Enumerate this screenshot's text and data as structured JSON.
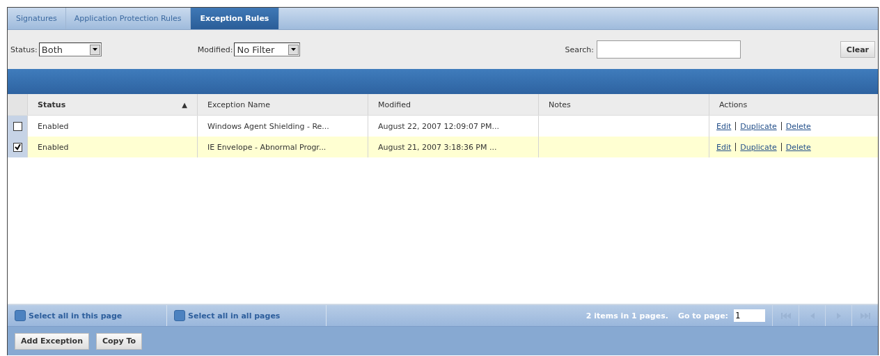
{
  "tabs": [
    {
      "label": "Signatures",
      "selected": false
    },
    {
      "label": "Application Protection Rules",
      "selected": false
    },
    {
      "label": "Exception Rules",
      "selected": true
    }
  ],
  "filters": {
    "status_label": "Status:",
    "status_value": "Both",
    "modified_label": "Modified:",
    "modified_value": "No Filter",
    "search_label": "Search:",
    "clear_button": "Clear"
  },
  "table": {
    "columns": [
      {
        "label": "Status",
        "sorted": true
      },
      {
        "label": "Exception Name",
        "sorted": false
      },
      {
        "label": "Modified",
        "sorted": false
      },
      {
        "label": "Notes",
        "sorted": false
      },
      {
        "label": "Actions",
        "sorted": false
      }
    ],
    "sort_arrow": "▲",
    "rows": [
      {
        "checked": false,
        "selected": false,
        "status": "Enabled",
        "name": "Windows Agent Shielding - Re...",
        "modified": "August 22, 2007 12:09:07 PM...",
        "actions": [
          "Edit",
          "Duplicate",
          "Delete"
        ]
      },
      {
        "checked": true,
        "selected": true,
        "status": "Enabled",
        "name": "IE Envelope - Abnormal Progr...",
        "modified": "August 21, 2007 3:18:36 PM ...",
        "actions": [
          "Edit",
          "Duplicate",
          "Delete"
        ]
      }
    ]
  },
  "footer": {
    "select_page": "Select all in this page",
    "select_page_checked": false,
    "select_all": "Select all in all pages",
    "select_all_checked": false,
    "summary": "2 items in 1 pages.",
    "goto_label": "Go to page:",
    "goto_value": "1"
  },
  "buttons": [
    "Add Exception",
    "Copy To"
  ]
}
